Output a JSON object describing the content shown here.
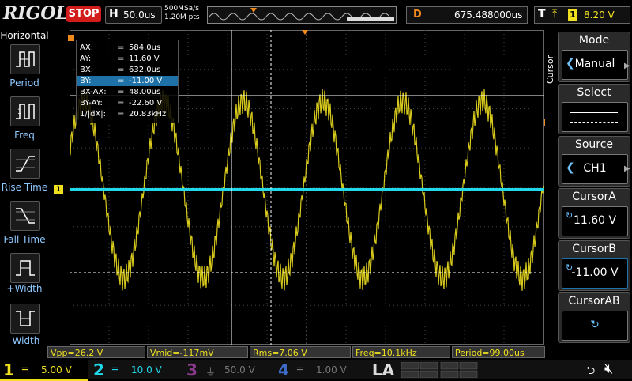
{
  "brand": "RIGOL",
  "run_state": "STOP",
  "horizontal": {
    "key": "H",
    "timebase": "50.0us"
  },
  "acquisition": {
    "sample_rate": "500MSa/s",
    "points": "1.20M pts"
  },
  "delay": {
    "key": "D",
    "value": "675.488000us"
  },
  "trigger": {
    "key": "T",
    "source": "1",
    "level": "8.20 V"
  },
  "left_menu": {
    "title": "Horizontal",
    "items": [
      {
        "label": "Period",
        "icon": "period-icon"
      },
      {
        "label": "Freq",
        "icon": "freq-icon"
      },
      {
        "label": "Rise Time",
        "icon": "rise-time-icon"
      },
      {
        "label": "Fall Time",
        "icon": "fall-time-icon"
      },
      {
        "label": "+Width",
        "icon": "positive-width-icon"
      },
      {
        "label": "-Width",
        "icon": "negative-width-icon"
      }
    ]
  },
  "cursor_readout": {
    "rows": [
      {
        "name": "AX:",
        "eq": "=",
        "value": "584.0us"
      },
      {
        "name": "AY:",
        "eq": "=",
        "value": "11.60 V"
      },
      {
        "name": "BX:",
        "eq": "=",
        "value": "632.0us"
      },
      {
        "name": "BY:",
        "eq": "=",
        "value": "-11.00 V"
      },
      {
        "name": "BX-AX:",
        "eq": "=",
        "value": "48.00us"
      },
      {
        "name": "BY-AY:",
        "eq": "=",
        "value": "-22.60 V"
      },
      {
        "name": "1/|dX|:",
        "eq": "=",
        "value": "20.83kHz"
      }
    ],
    "selected_row": 3
  },
  "right_menu": {
    "vertical_label": "Cursor",
    "mode": {
      "title": "Mode",
      "value": "Manual"
    },
    "select": {
      "title": "Select"
    },
    "source": {
      "title": "Source",
      "value": "CH1"
    },
    "cursor_a": {
      "title": "CursorA",
      "value": "11.60 V"
    },
    "cursor_b": {
      "title": "CursorB",
      "value": "-11.00 V"
    },
    "cursor_ab": {
      "title": "CursorAB"
    }
  },
  "measurements": [
    {
      "label": "Vpp=26.2 V"
    },
    {
      "label": "Vmid=-117mV"
    },
    {
      "label": "Rms=7.06 V"
    },
    {
      "label": "Freq=10.1kHz"
    },
    {
      "label": "Period=99.00us"
    }
  ],
  "channels": [
    {
      "num": "1",
      "coupling": "═",
      "scale": "5.00 V",
      "color": "#f0e020"
    },
    {
      "num": "2",
      "coupling": "═",
      "scale": "10.0 V",
      "color": "#20d8e8"
    },
    {
      "num": "3",
      "coupling": "⏚",
      "scale": "50.0 V",
      "color": "#c040c0"
    },
    {
      "num": "4",
      "coupling": "═",
      "scale": "1.00 V",
      "color": "#3c6cc8"
    }
  ],
  "la_label": "LA",
  "colors": {
    "ch1": "#f0e020",
    "ch2": "#20d8e8",
    "accent_orange": "#f08a1c",
    "stop_red": "#d21b1b",
    "selected_blue": "#1e72a8"
  }
}
